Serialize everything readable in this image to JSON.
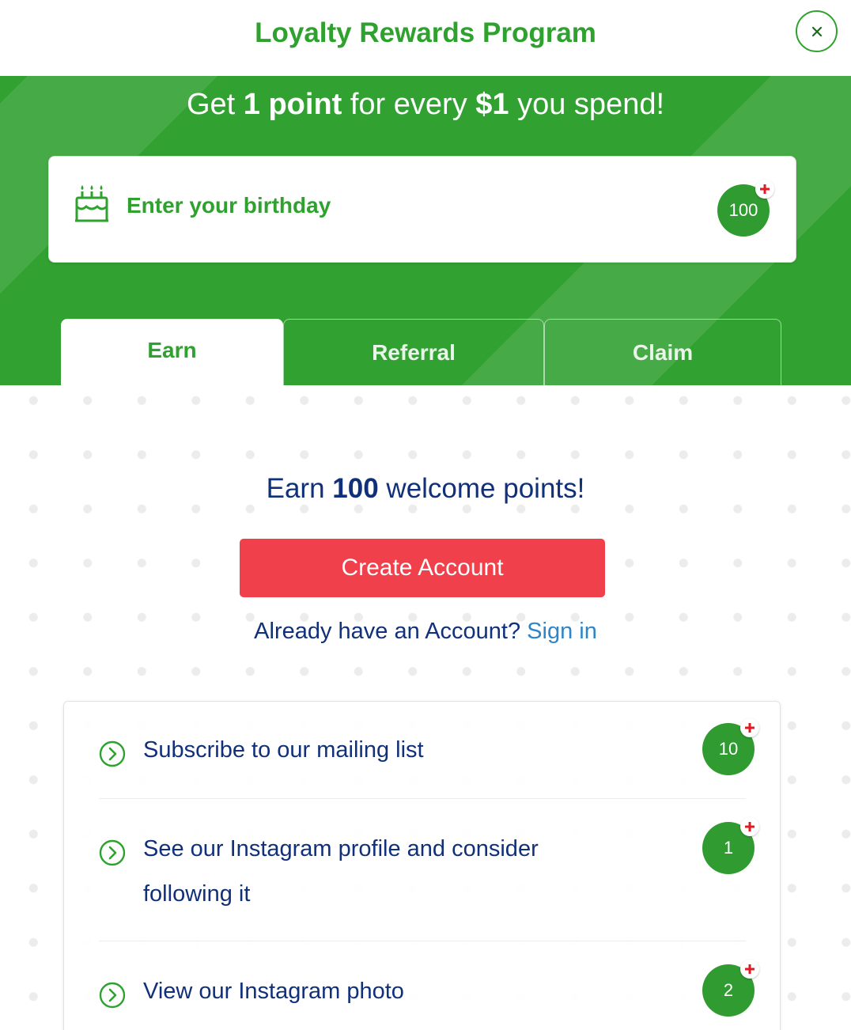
{
  "header": {
    "title": "Loyalty Rewards Program",
    "close_label": "×"
  },
  "banner": {
    "headline_prefix": "Get ",
    "headline_points": "1 point",
    "headline_middle": " for every ",
    "headline_amount": "$1",
    "headline_suffix": " you spend!",
    "birthday": {
      "label": "Enter your birthday",
      "points": "100"
    }
  },
  "tabs": [
    {
      "label": "Earn",
      "active": true
    },
    {
      "label": "Referral",
      "active": false
    },
    {
      "label": "Claim",
      "active": false
    }
  ],
  "welcome": {
    "prefix": "Earn ",
    "points": "100",
    "suffix": " welcome points!",
    "create_account_label": "Create Account",
    "signin_prompt": "Already have an Account? ",
    "signin_link": "Sign in"
  },
  "earn_items": [
    {
      "label": "Subscribe to our mailing list",
      "points": "10"
    },
    {
      "label": "See our Instagram profile and consider following it",
      "points": "1"
    },
    {
      "label": "View our Instagram photo",
      "points": "2"
    }
  ],
  "colors": {
    "brand_green": "#31a231",
    "badge_green": "#2f9b30",
    "title_navy": "#10307a",
    "cta_red": "#f0404b",
    "link_blue": "#2e86c9",
    "plus_red": "#e01b24"
  }
}
